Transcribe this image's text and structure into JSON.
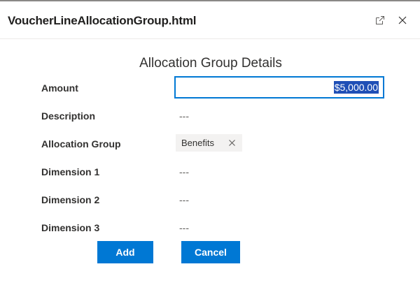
{
  "window": {
    "title": "VoucherLineAllocationGroup.html"
  },
  "form": {
    "title": "Allocation Group Details",
    "amount": {
      "label": "Amount",
      "value": "$5,000.00"
    },
    "description": {
      "label": "Description",
      "value": "---"
    },
    "allocation_group": {
      "label": "Allocation Group",
      "tag": "Benefits"
    },
    "dimension1": {
      "label": "Dimension 1",
      "value": "---"
    },
    "dimension2": {
      "label": "Dimension 2",
      "value": "---"
    },
    "dimension3": {
      "label": "Dimension 3",
      "value": "---"
    }
  },
  "actions": {
    "add_label": "Add",
    "cancel_label": "Cancel"
  },
  "icons": {
    "popout": "popout-icon",
    "close": "close-icon",
    "tag_remove": "close-icon"
  },
  "colors": {
    "primary": "#0078d4",
    "selection": "#1f4fb6",
    "tag_bg": "#f3f2f1"
  }
}
